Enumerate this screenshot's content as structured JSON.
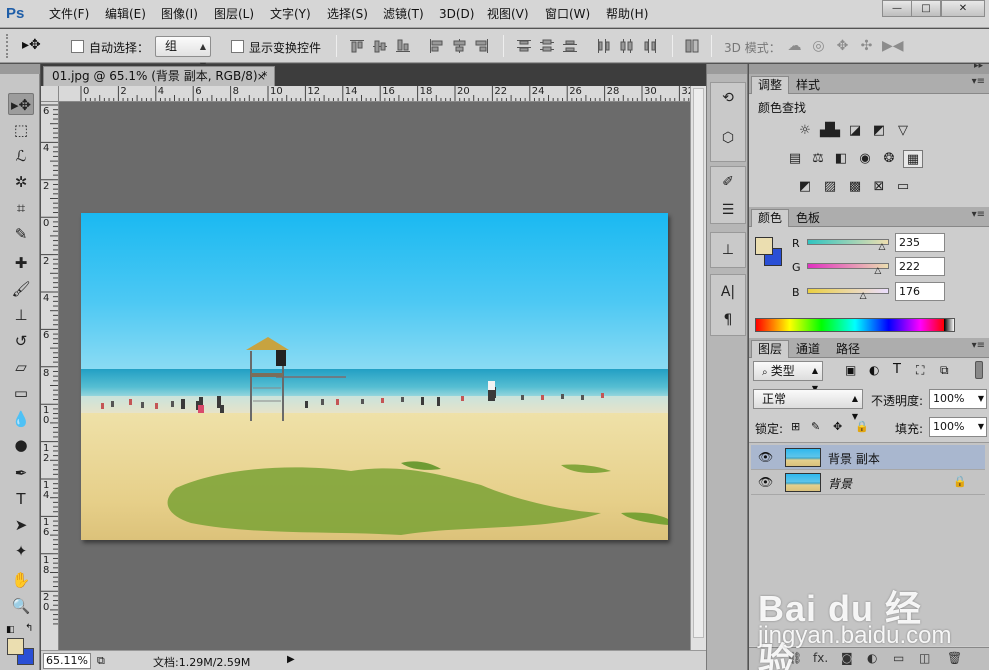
{
  "app": {
    "logo": "Ps"
  },
  "menu": [
    "文件(F)",
    "编辑(E)",
    "图像(I)",
    "图层(L)",
    "文字(Y)",
    "选择(S)",
    "滤镜(T)",
    "3D(D)",
    "视图(V)",
    "窗口(W)",
    "帮助(H)"
  ],
  "window_controls": {
    "minimize": "—",
    "maximize": "□",
    "close": "✕"
  },
  "options": {
    "auto_select_label": "自动选择：",
    "auto_select_value": "组",
    "show_transform_label": "显示变换控件",
    "mode_3d_label": "3D 模式："
  },
  "document": {
    "tab_title": "01.jpg @ 65.1% (背景 副本, RGB/8) *",
    "tab_close": "×",
    "zoom": "65.11%",
    "status": "文档:1.29M/2.59M"
  },
  "ruler": {
    "top_ticks": [
      "0",
      "2",
      "4",
      "6",
      "8",
      "10",
      "12",
      "14",
      "16",
      "18",
      "20",
      "22",
      "24",
      "26",
      "28",
      "30",
      "32"
    ],
    "left_ticks": [
      "6",
      "4",
      "2",
      "0",
      "2",
      "4",
      "6",
      "8",
      "1 0",
      "1 2",
      "1 4",
      "1 6",
      "1 8",
      "2 0"
    ]
  },
  "adjustments_panel": {
    "tabs": [
      "调整",
      "样式"
    ],
    "title": "颜色查找"
  },
  "color_panel": {
    "tabs": [
      "颜色",
      "色板"
    ],
    "channels": [
      {
        "name": "R",
        "value": "235",
        "level": 0.92
      },
      {
        "name": "G",
        "value": "222",
        "level": 0.87
      },
      {
        "name": "B",
        "value": "176",
        "level": 0.69
      }
    ],
    "foreground": "#ebdeb0",
    "background": "#2a4fd5"
  },
  "layers_panel": {
    "tabs": [
      "图层",
      "通道",
      "路径"
    ],
    "kind_filter": "类型",
    "blend_mode": "正常",
    "opacity_label": "不透明度:",
    "opacity_value": "100%",
    "lock_label": "锁定:",
    "fill_label": "填充:",
    "fill_value": "100%",
    "layers": [
      {
        "name": "背景 副本",
        "selected": true,
        "locked": false
      },
      {
        "name": "背景",
        "selected": false,
        "locked": true
      }
    ]
  },
  "watermark": {
    "brand": "Bai du 经验",
    "site": "jingyan.baidu.com"
  }
}
